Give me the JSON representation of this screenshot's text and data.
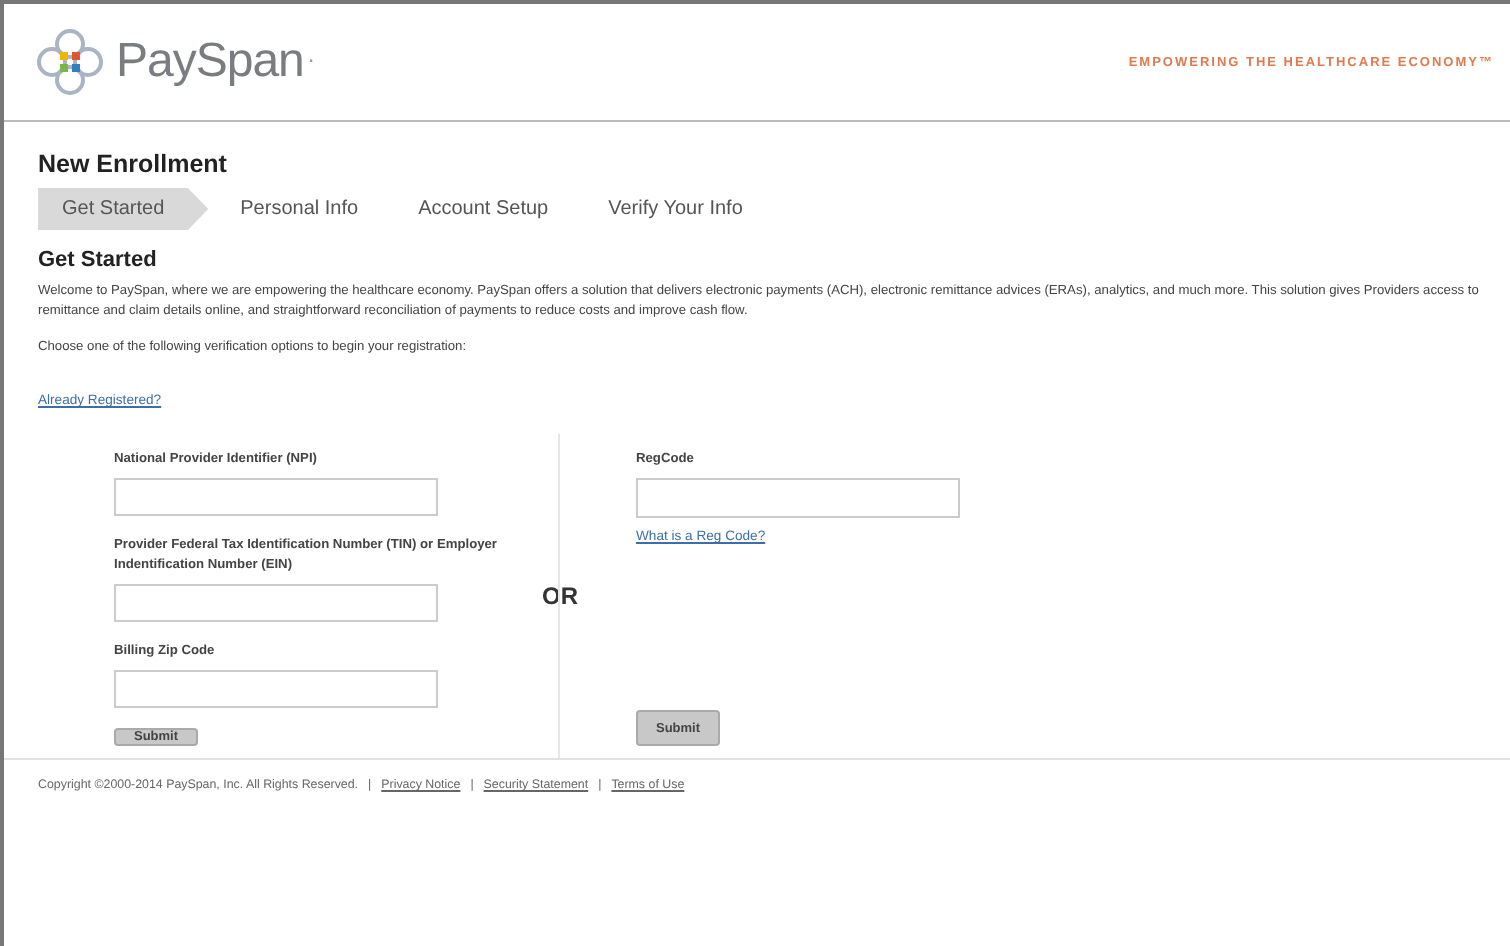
{
  "header": {
    "brand": "PaySpan",
    "brand_mark": ".",
    "tagline": "EMPOWERING THE HEALTHCARE ECONOMY™"
  },
  "page_title": "New Enrollment",
  "steps": [
    {
      "label": "Get Started",
      "selected": true
    },
    {
      "label": "Personal Info",
      "selected": false
    },
    {
      "label": "Account Setup",
      "selected": false
    },
    {
      "label": "Verify Your Info",
      "selected": false
    }
  ],
  "section_title": "Get Started",
  "intro": "Welcome to PaySpan, where we are empowering the healthcare economy. PaySpan offers a solution that delivers electronic payments (ACH), electronic remittance advices (ERAs), analytics, and much more. This solution gives Providers access to remittance and claim details online, and straightforward reconciliation of payments to reduce costs and improve cash flow.",
  "instruction": "Choose one of the following verification options to begin your registration:",
  "already_registered_link": "Already Registered?",
  "left_form": {
    "fields": [
      {
        "label": "National Provider Identifier (NPI)"
      },
      {
        "label": "Provider Federal Tax Identification Number (TIN) or Employer Indentification Number (EIN)"
      },
      {
        "label": "Billing Zip Code"
      }
    ],
    "submit": "Submit"
  },
  "or_label": "OR",
  "right_form": {
    "fields": [
      {
        "label": "RegCode"
      }
    ],
    "help_link": "What is a Reg Code?",
    "submit": "Submit"
  },
  "footer": {
    "copyright": "Copyright ©2000-2014 PaySpan, Inc. All Rights Reserved.",
    "links": [
      "Privacy Notice",
      "Security Statement",
      "Terms of Use"
    ],
    "separator": "|"
  }
}
